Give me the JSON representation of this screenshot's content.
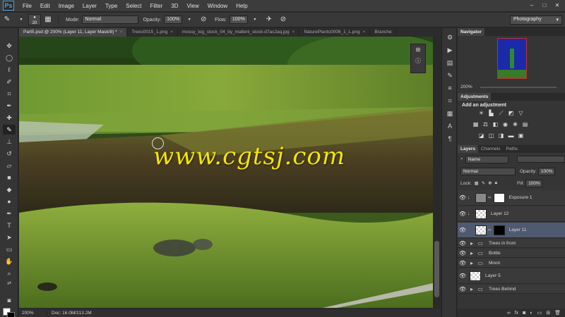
{
  "app": {
    "logo": "Ps"
  },
  "menu": [
    "File",
    "Edit",
    "Image",
    "Layer",
    "Type",
    "Select",
    "Filter",
    "3D",
    "View",
    "Window",
    "Help"
  ],
  "window_controls": [
    "–",
    "□",
    "✕"
  ],
  "options": {
    "brush_size": "20",
    "mode_label": "Mode:",
    "mode_value": "Normal",
    "opacity_label": "Opacity:",
    "opacity_value": "100%",
    "flow_label": "Flow:",
    "flow_value": "100%",
    "workspace": "Photography"
  },
  "doc_tabs": [
    "Part5.psd @ 200% (Layer 11, Layer Mask/8) *",
    "Trees0015_1.png",
    "mossy_log_stock_04_by_malleni_stock-d7ac2aq.jpg",
    "NaturePlants0006_1_L.png",
    "Branche"
  ],
  "canvas": {
    "watermark": "www.cgtsj.com"
  },
  "status": {
    "zoom": "200%",
    "doc": "Doc: 16.0M/213.2M"
  },
  "navigator": {
    "title": "Navigator",
    "zoom": "200%"
  },
  "adjustments": {
    "title": "Adjustments",
    "subtitle": "Add an adjustment"
  },
  "layers_panel": {
    "tabs": [
      "Layers",
      "Channels",
      "Paths"
    ],
    "kind_filter": "Name",
    "blend_mode": "Normal",
    "opacity_label": "Opacity:",
    "opacity_value": "100%",
    "lock_label": "Lock:",
    "fill_label": "Fill:",
    "fill_value": "100%",
    "layers": [
      {
        "name": "Exposure 1",
        "type": "adjustment"
      },
      {
        "name": "Layer 12",
        "type": "layer"
      },
      {
        "name": "Layer 11",
        "type": "masked",
        "selected": true
      },
      {
        "name": "Trees in front",
        "type": "group"
      },
      {
        "name": "Bottle",
        "type": "group"
      },
      {
        "name": "Moon",
        "type": "group"
      },
      {
        "name": "Layer 5",
        "type": "layer"
      },
      {
        "name": "Trees Behind",
        "type": "group"
      }
    ]
  },
  "colors": {
    "accent_selected": "#4f5a70",
    "watermark": "#f2e600"
  }
}
